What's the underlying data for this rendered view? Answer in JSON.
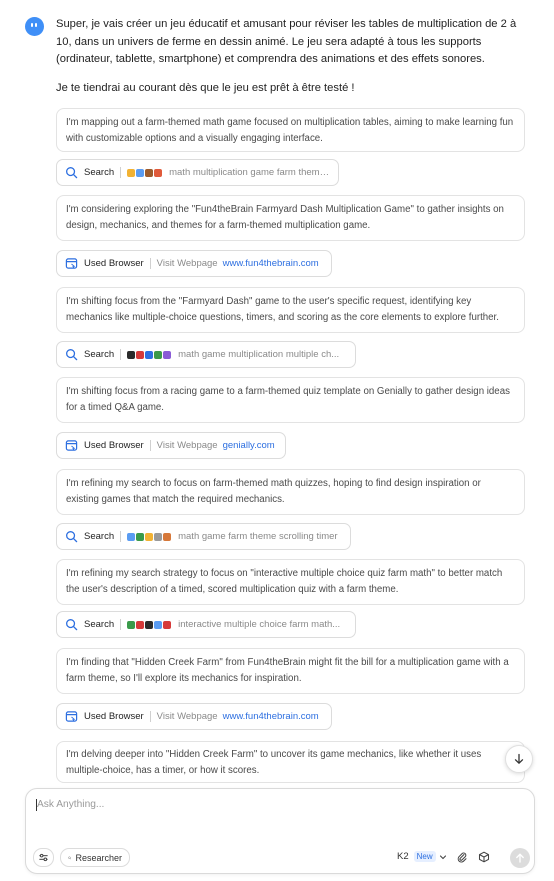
{
  "message": {
    "paragraph1": "Super, je vais créer un jeu éducatif et amusant pour réviser les tables de multiplication de 2 à 10, dans un univers de ferme en dessin animé. Le jeu sera adapté à tous les supports (ordinateur, tablette, smartphone) et comprendra des animations et des effets sonores.",
    "paragraph2": "Je te tiendrai au courant dès que le jeu est prêt à être testé !"
  },
  "steps": [
    {
      "kind": "thought",
      "text": "I'm mapping out a farm-themed math game focused on multiplication tables, aiming to make learning fun with customizable options and a visually engaging interface."
    },
    {
      "kind": "search",
      "label": "Search",
      "query": "math multiplication game farm theme...",
      "favicons": [
        "#f2b233",
        "#5a9cf2",
        "#9d5b2b",
        "#e05a3a"
      ]
    },
    {
      "kind": "thought",
      "text": "I'm considering exploring the \"Fun4theBrain Farmyard Dash Multiplication Game\" to gather insights on design, mechanics, and themes for a farm-themed multiplication game."
    },
    {
      "kind": "browser",
      "label": "Used Browser",
      "action": "Visit Webpage",
      "url": "www.fun4thebrain.com"
    },
    {
      "kind": "thought",
      "text": "I'm shifting focus from the \"Farmyard Dash\" game to the user's specific request, identifying key mechanics like multiple-choice questions, timers, and scoring as the core elements to explore further."
    },
    {
      "kind": "search",
      "label": "Search",
      "query": "math game multiplication multiple ch...",
      "favicons": [
        "#2b2b2b",
        "#d63a3a",
        "#2d6fe0",
        "#3a9a4a",
        "#8a5bd6"
      ]
    },
    {
      "kind": "thought",
      "text": "I'm shifting focus from a racing game to a farm-themed quiz template on Genially to gather design ideas for a timed Q&A game."
    },
    {
      "kind": "browser",
      "label": "Used Browser",
      "action": "Visit Webpage",
      "url": "genially.com"
    },
    {
      "kind": "thought",
      "text": "I'm refining my search to focus on farm-themed math quizzes, hoping to find design inspiration or existing games that match the required mechanics."
    },
    {
      "kind": "search",
      "label": "Search",
      "query": "math game farm theme scrolling timer",
      "favicons": [
        "#5a9cf2",
        "#3a9a4a",
        "#f2b233",
        "#9a9a9a",
        "#d6783a"
      ]
    },
    {
      "kind": "thought",
      "text": "I'm refining my search strategy to focus on \"interactive multiple choice quiz farm math\" to better match the user's description of a timed, scored multiplication quiz with a farm theme."
    },
    {
      "kind": "search",
      "label": "Search",
      "query": "interactive multiple choice farm math...",
      "favicons": [
        "#3a9a4a",
        "#d63a3a",
        "#2b2b2b",
        "#5a9cf2",
        "#d63a3a"
      ]
    },
    {
      "kind": "thought",
      "text": "I'm finding that \"Hidden Creek Farm\" from Fun4theBrain might fit the bill for a multiplication game with a farm theme, so I'll explore its mechanics for inspiration."
    },
    {
      "kind": "browser",
      "label": "Used Browser",
      "action": "Visit Webpage",
      "url": "www.fun4thebrain.com"
    },
    {
      "kind": "thought",
      "text": "I'm delving deeper into \"Hidden Creek Farm\" to uncover its game mechanics, like whether it uses multiple-choice, has a timer, or how it scores."
    }
  ],
  "composer": {
    "placeholder": "Ask Anything...",
    "researcher_label": "Researcher",
    "model_label": "K2",
    "model_badge": "New"
  },
  "colors": {
    "accent": "#2d6fe0",
    "avatar": "#3f8ff7"
  }
}
